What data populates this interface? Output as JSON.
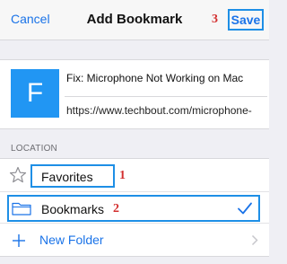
{
  "header": {
    "cancel_label": "Cancel",
    "title": "Add Bookmark",
    "save_label": "Save",
    "save_marker": "3"
  },
  "bookmark": {
    "favicon_letter": "F",
    "title": "Fix: Microphone Not Working on Mac",
    "url": "https://www.techbout.com/microphone-"
  },
  "location": {
    "section_header": "LOCATION",
    "items": [
      {
        "label": "Favorites",
        "icon": "star-icon",
        "marker": "1"
      },
      {
        "label": "Bookmarks",
        "icon": "folder-icon",
        "marker": "2",
        "selected": true
      },
      {
        "label": "New Folder",
        "icon": "plus-icon"
      }
    ]
  },
  "colors": {
    "accent": "#1a73e8",
    "highlight_box": "#1e8fe6",
    "marker": "#d32f2f",
    "favicon_bg": "#2196f3"
  }
}
